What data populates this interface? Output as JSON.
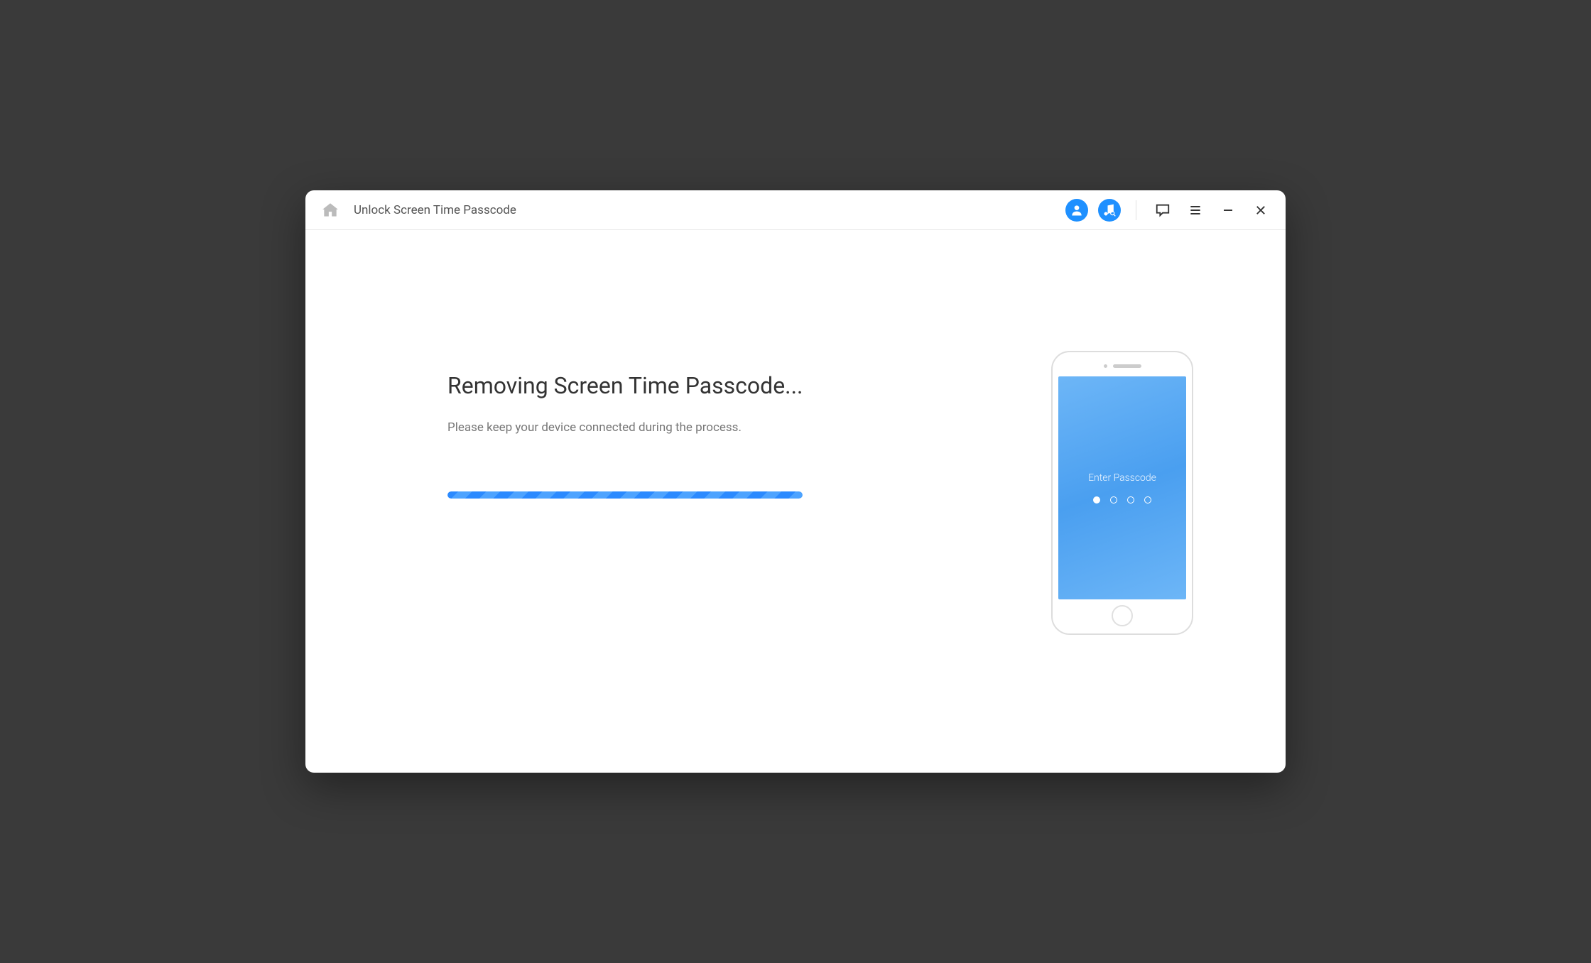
{
  "header": {
    "title": "Unlock Screen Time Passcode"
  },
  "main": {
    "heading": "Removing Screen Time Passcode...",
    "subtext": "Please keep your device connected during the process."
  },
  "phone": {
    "screen_label": "Enter Passcode"
  }
}
